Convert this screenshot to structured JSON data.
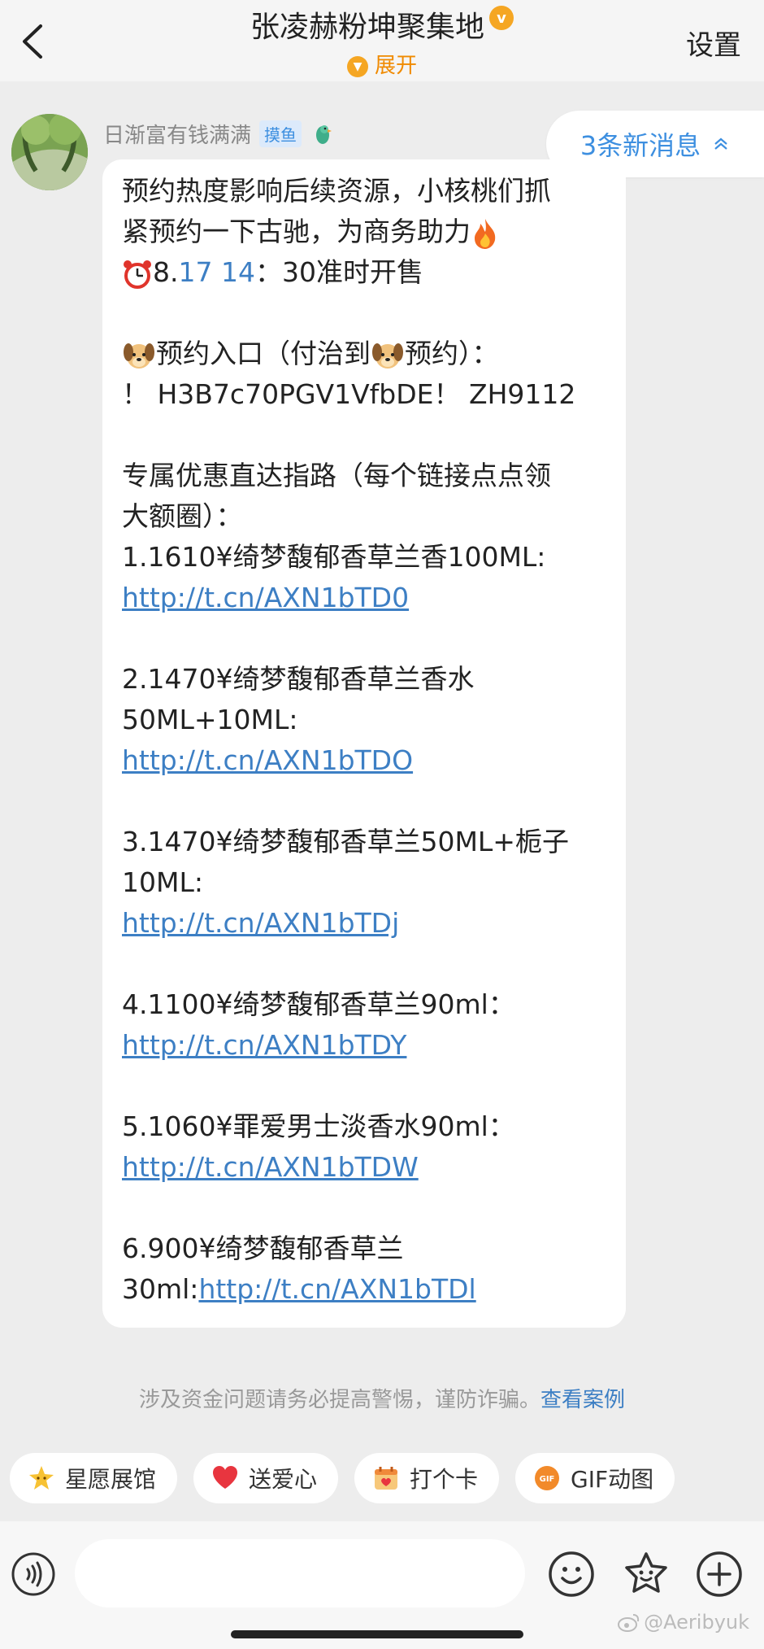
{
  "header": {
    "title": "张凌赫粉坤聚集地",
    "expand_label": "展开",
    "settings_label": "设置"
  },
  "sender": {
    "name": "日渐富有钱满满",
    "tag": "摸鱼"
  },
  "new_messages_label": "3条新消息",
  "message": {
    "line1": "预约热度影响后续资源，小核桃们抓",
    "line2_text": "紧预约一下古驰，为商务助力",
    "line3_pre": "8.",
    "line3_date": "17 14",
    "line3_post": "：30准时开售",
    "line4_pre": "预约入口（付治到",
    "line4_post": "预约）：",
    "line5": "！ H3B7c70PGV1VfbDE！  ZH9112",
    "line6": "专属优惠直达指路（每个链接点点领",
    "line7": "大额圈）：",
    "item1_text": "1.1610¥绮梦馥郁香草兰香100ML:",
    "item1_link": "http://t.cn/AXN1bTD0",
    "item2_text_a": "2.1470¥绮梦馥郁香草兰香水",
    "item2_text_b": "50ML+10ML:",
    "item2_link": "http://t.cn/AXN1bTDO",
    "item3_text_a": "3.1470¥绮梦馥郁香草兰50ML+栀子",
    "item3_text_b": "10ML:",
    "item3_link": "http://t.cn/AXN1bTDj",
    "item4_text": "4.1100¥绮梦馥郁香草兰90ml：",
    "item4_link": "http://t.cn/AXN1bTDY",
    "item5_text": "5.1060¥罪爱男士淡香水90ml：",
    "item5_link": "http://t.cn/AXN1bTDW",
    "item6_text_a": "6.900¥绮梦馥郁香草兰",
    "item6_text_b": "30ml:",
    "item6_link": "http://t.cn/AXN1bTDl"
  },
  "warning": {
    "text": "涉及资金问题请务必提高警惕，谨防诈骗。",
    "link": "查看案例"
  },
  "quick_actions": [
    {
      "label": "星愿展馆",
      "icon": "star-icon"
    },
    {
      "label": "送爱心",
      "icon": "heart-icon"
    },
    {
      "label": "打个卡",
      "icon": "checkin-icon"
    },
    {
      "label": "GIF动图",
      "icon": "gif-icon"
    }
  ],
  "watermark": "@Aeribyuk",
  "colors": {
    "accent": "#3d7fc4",
    "orange": "#f08a00",
    "background": "#ededed"
  }
}
